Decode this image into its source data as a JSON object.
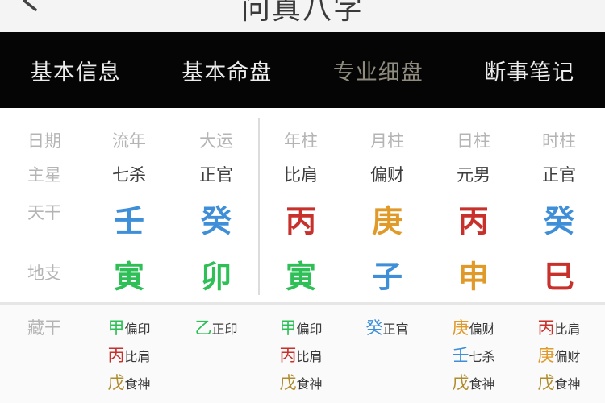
{
  "header": {
    "title": "问真八字"
  },
  "tabs": [
    {
      "label": "基本信息",
      "active": false
    },
    {
      "label": "基本命盘",
      "active": false
    },
    {
      "label": "专业细盘",
      "active": true
    },
    {
      "label": "断事笔记",
      "active": false
    }
  ],
  "chart": {
    "row_labels": {
      "date": "日期",
      "main_star": "主星",
      "stem": "天干",
      "branch": "地支",
      "hidden": "藏干"
    },
    "columns": [
      {
        "id": "liunian",
        "header": "流年",
        "main_star": "七杀",
        "stem": "壬",
        "stem_color": "#3f8fd8",
        "branch": "寅",
        "branch_color": "#2fbf57"
      },
      {
        "id": "dayun",
        "header": "大运",
        "main_star": "正官",
        "stem": "癸",
        "stem_color": "#3f8fd8",
        "branch": "卯",
        "branch_color": "#2fbf57"
      },
      {
        "id": "nianzhu",
        "header": "年柱",
        "main_star": "比肩",
        "stem": "丙",
        "stem_color": "#c8302c",
        "branch": "寅",
        "branch_color": "#2fbf57"
      },
      {
        "id": "yuezhu",
        "header": "月柱",
        "main_star": "偏财",
        "stem": "庚",
        "stem_color": "#e09a2a",
        "branch": "子",
        "branch_color": "#3f8fd8"
      },
      {
        "id": "rizhu",
        "header": "日柱",
        "main_star": "元男",
        "stem": "丙",
        "stem_color": "#c8302c",
        "branch": "申",
        "branch_color": "#e09a2a"
      },
      {
        "id": "shizhu",
        "header": "时柱",
        "main_star": "正官",
        "stem": "癸",
        "stem_color": "#3f8fd8",
        "branch": "巳",
        "branch_color": "#c8302c"
      }
    ],
    "hidden_stems": [
      [
        {
          "char": "甲",
          "god": "偏印",
          "color": "#2fbf57"
        },
        {
          "char": "丙",
          "god": "比肩",
          "color": "#c8302c"
        },
        {
          "char": "戊",
          "god": "食神",
          "color": "#b08c2c"
        }
      ],
      [
        {
          "char": "乙",
          "god": "正印",
          "color": "#2fbf57"
        }
      ],
      [
        {
          "char": "甲",
          "god": "偏印",
          "color": "#2fbf57"
        },
        {
          "char": "丙",
          "god": "比肩",
          "color": "#c8302c"
        },
        {
          "char": "戊",
          "god": "食神",
          "color": "#b08c2c"
        }
      ],
      [
        {
          "char": "癸",
          "god": "正官",
          "color": "#3f8fd8"
        }
      ],
      [
        {
          "char": "庚",
          "god": "偏财",
          "color": "#e09a2a"
        },
        {
          "char": "壬",
          "god": "七杀",
          "color": "#3f8fd8"
        },
        {
          "char": "戊",
          "god": "食神",
          "color": "#b08c2c"
        }
      ],
      [
        {
          "char": "丙",
          "god": "比肩",
          "color": "#c8302c"
        },
        {
          "char": "庚",
          "god": "偏财",
          "color": "#e09a2a"
        },
        {
          "char": "戊",
          "god": "食神",
          "color": "#b08c2c"
        }
      ]
    ]
  }
}
